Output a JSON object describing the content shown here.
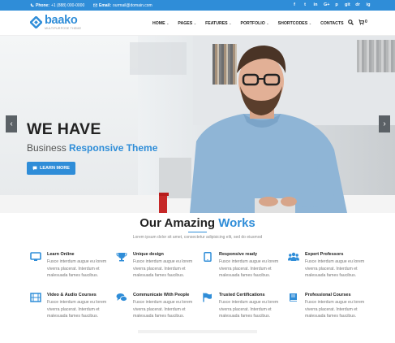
{
  "topbar": {
    "phone_label": "Phone:",
    "phone_value": "+1 (888) 000-0000",
    "email_label": "Email:",
    "email_value": "ourmail@domain.com",
    "socials": [
      "f",
      "t",
      "in",
      "G+",
      "p",
      "git",
      "dr",
      "ig"
    ]
  },
  "header": {
    "logo_name": "baako",
    "logo_tagline": "MULTIPURPOSE THEME",
    "nav": [
      {
        "label": "HOME",
        "has_dropdown": true
      },
      {
        "label": "PAGES",
        "has_dropdown": true
      },
      {
        "label": "FEATURES",
        "has_dropdown": true
      },
      {
        "label": "PORTFOLIO",
        "has_dropdown": true
      },
      {
        "label": "SHORTCODES",
        "has_dropdown": true
      },
      {
        "label": "CONTACTS",
        "has_dropdown": false
      }
    ],
    "cart_count": "0"
  },
  "hero": {
    "title": "WE HAVE",
    "subtitle_plain": "Business ",
    "subtitle_accent": "Responsive Theme",
    "button_label": "LEARN MORE",
    "prev_arrow": "‹",
    "next_arrow": "›"
  },
  "works": {
    "title_plain": "Our Amazing ",
    "title_accent": "Works",
    "subtitle": "Lorem ipsum dolor sit amet, consectetur adipisicing elit, sed do eiusmod",
    "features": [
      {
        "title": "Learn Online",
        "icon": "monitor-icon",
        "desc": "Fusce interdum augue eu lorem viverra placerat. Interdum et malesuada fames faucibus."
      },
      {
        "title": "Unique design",
        "icon": "trophy-icon",
        "desc": "Fusce interdum augue eu lorem viverra placerat. Interdum et malesuada fames faucibus."
      },
      {
        "title": "Responsive ready",
        "icon": "tablet-icon",
        "desc": "Fusce interdum augue eu lorem viverra placerat. Interdum et malesuada fames faucibus."
      },
      {
        "title": "Expert Professors",
        "icon": "users-icon",
        "desc": "Fusce interdum augue eu lorem viverra placerat. Interdum et malesuada fames faucibus."
      },
      {
        "title": "Video & Audio Courses",
        "icon": "film-icon",
        "desc": "Fusce interdum augue eu lorem viverra placerat. Interdum et malesuada fames faucibus."
      },
      {
        "title": "Communicate With People",
        "icon": "chat-icon",
        "desc": "Fusce interdum augue eu lorem viverra placerat. Interdum et malesuada fames faucibus."
      },
      {
        "title": "Trusted Certifications",
        "icon": "flag-icon",
        "desc": "Fusce interdum augue eu lorem viverra placerat. Interdum et malesuada fames faucibus."
      },
      {
        "title": "Professional Courses",
        "icon": "book-icon",
        "desc": "Fusce interdum augue eu lorem viverra placerat. Interdum et malesuada fames faucibus."
      }
    ]
  },
  "colors": {
    "accent": "#2f8dd8",
    "dark_text": "#222222",
    "muted_text": "#777777"
  }
}
